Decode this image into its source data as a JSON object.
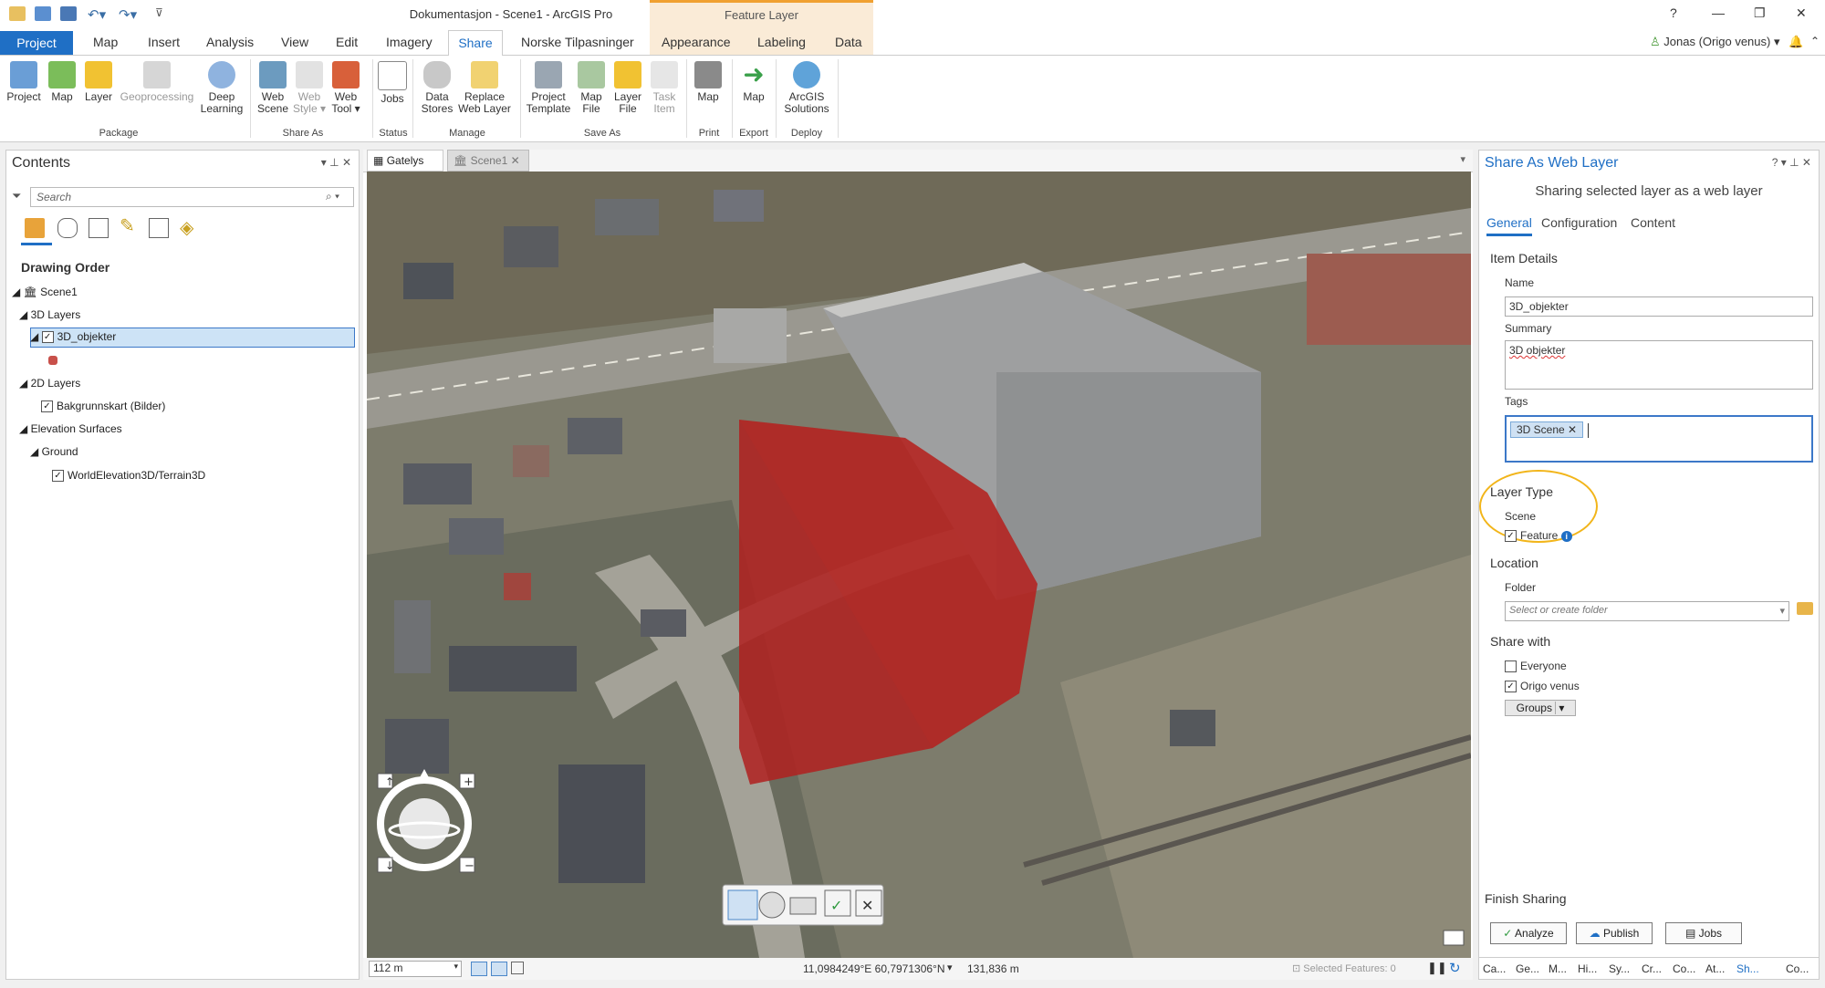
{
  "window": {
    "title": "Dokumentasjon - Scene1 - ArcGIS Pro",
    "context_tab": "Feature Layer",
    "help": "?",
    "user": "Jonas (Origo venus)"
  },
  "tabs": [
    "Project",
    "Map",
    "Insert",
    "Analysis",
    "View",
    "Edit",
    "Imagery",
    "Share",
    "Norske Tilpasninger",
    "Appearance",
    "Labeling",
    "Data"
  ],
  "active_tab": "Share",
  "ribbon": {
    "project": "Project",
    "map": "Map",
    "layer": "Layer",
    "geoprocessing": "Geoprocessing",
    "deep1": "Deep",
    "deep2": "Learning",
    "webscene1": "Web",
    "webscene2": "Scene",
    "webstyle1": "Web",
    "webstyle2": "Style",
    "webtool1": "Web",
    "webtool2": "Tool",
    "jobs": "Jobs",
    "datastores1": "Data",
    "datastores2": "Stores",
    "replace1": "Replace",
    "replace2": "Web Layer",
    "ptemplate1": "Project",
    "ptemplate2": "Template",
    "mapfile1": "Map",
    "mapfile2": "File",
    "layerfile1": "Layer",
    "layerfile2": "File",
    "taskitem1": "Task",
    "taskitem2": "Item",
    "printmap": "Map",
    "exportmap": "Map",
    "sol1": "ArcGIS",
    "sol2": "Solutions",
    "groups": {
      "package": "Package",
      "shareas": "Share As",
      "status": "Status",
      "manage": "Manage",
      "saveas": "Save As",
      "print": "Print",
      "export": "Export",
      "deploy": "Deploy"
    }
  },
  "contents": {
    "title": "Contents",
    "search_placeholder": "Search",
    "drawing_order": "Drawing Order",
    "scene": "Scene1",
    "layers3d": "3D Layers",
    "layer_3d": "3D_objekter",
    "layers2d": "2D Layers",
    "basemap": "Bakgrunnskart (Bilder)",
    "elevation": "Elevation Surfaces",
    "ground": "Ground",
    "terrain": "WorldElevation3D/Terrain3D"
  },
  "view": {
    "tab1": "Gatelys",
    "tab2": "Scene1",
    "scale": "112 m",
    "coords": "11,0984249°E 60,7971306°N",
    "elevation": "131,836 m",
    "selected": "Selected Features: 0"
  },
  "share": {
    "title": "Share As Web Layer",
    "subtitle": "Sharing selected layer as a web layer",
    "tabs": [
      "General",
      "Configuration",
      "Content"
    ],
    "item_details": "Item Details",
    "name_label": "Name",
    "name_value": "3D_objekter",
    "summary_label": "Summary",
    "summary_value": "3D objekter",
    "tags_label": "Tags",
    "tag": "3D Scene",
    "layer_type": "Layer Type",
    "scene": "Scene",
    "feature": "Feature",
    "location": "Location",
    "folder_label": "Folder",
    "folder_placeholder": "Select or create folder",
    "share_with": "Share with",
    "everyone": "Everyone",
    "origo": "Origo venus",
    "groups": "Groups",
    "finish": "Finish Sharing",
    "analyze": "Analyze",
    "publish": "Publish",
    "jobs": "Jobs",
    "bottom_tabs": [
      "Ca...",
      "Ge...",
      "M...",
      "Hi...",
      "Sy...",
      "Cr...",
      "Co...",
      "At...",
      "Sh...",
      "Co..."
    ]
  },
  "colors": {
    "accent": "#1f6fc5",
    "building": "#b0201e",
    "highlight": "#f2b51a"
  }
}
